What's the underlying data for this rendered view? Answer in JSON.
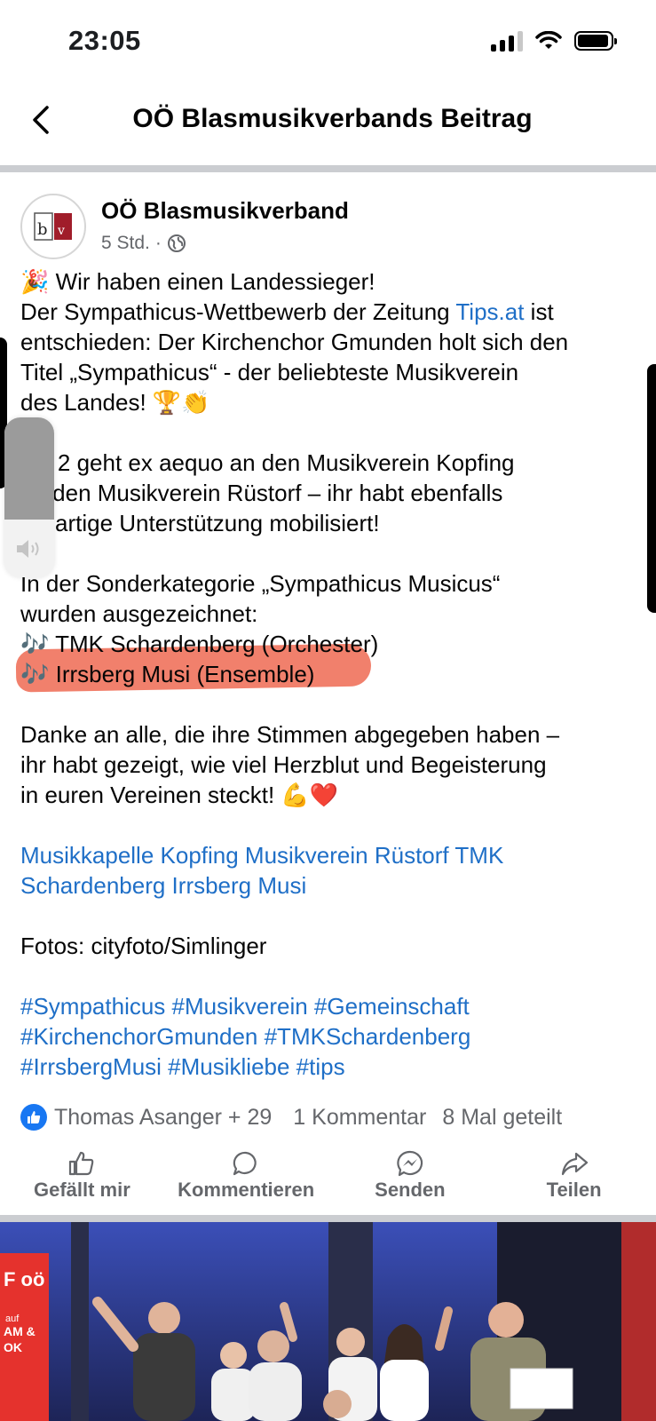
{
  "status_bar": {
    "time": "23:05"
  },
  "header": {
    "title": "OÖ Blasmusikverbands Beitrag"
  },
  "post": {
    "author": "OÖ Blasmusikverband",
    "time": "5 Std.",
    "separator": "·",
    "avatar_letters": "b v",
    "lines": {
      "l1_emoji": "🎉",
      "l1": "Wir haben einen Landessieger!",
      "l2_a": "Der Sympathicus-Wettbewerb der Zeitung ",
      "l2_link": "Tips.at",
      "l2_b": " ist",
      "l3": "entschieden: Der Kirchenchor Gmunden holt sich den",
      "l4": "Titel „Sympathicus“ - der beliebteste Musikverein",
      "l5": "des Landes! 🏆👏",
      "l6": "atz 2 geht ex aequo an den Musikverein Kopfing",
      "l7": "nd den Musikverein Rüstorf – ihr habt ebenfalls",
      "l8": "roßartige Unterstützung mobilisiert!",
      "l9": "In der Sonderkategorie „Sympathicus Musicus“",
      "l10": "wurden ausgezeichnet:",
      "l11": "🎶 TMK Schardenberg (Orchester)",
      "l12": "🎶 Irrsberg Musi (Ensemble)",
      "l13": "Danke an alle, die ihre Stimmen abgegeben haben –",
      "l14": "ihr habt gezeigt, wie viel Herzblut und Begeisterung",
      "l15": "in euren Vereinen steckt! 💪❤️",
      "tags_line1": " Musikkapelle Kopfing Musikverein Rüstorf TMK",
      "tags_line2": "Schardenberg Irrsberg Musi",
      "credits": "Fotos: cityfoto/Simlinger",
      "hashtags_line1": "#Sympathicus #Musikverein #Gemeinschaft",
      "hashtags_line2": "#KirchenchorGmunden #TMKSchardenberg",
      "hashtags_line3": "#IrrsbergMusi #Musikliebe #tips"
    }
  },
  "reactions": {
    "names": "Thomas Asanger + 29",
    "comments": "1 Kommentar",
    "shares": "8 Mal geteilt"
  },
  "actions": {
    "like": "Gefällt mir",
    "comment": "Kommentieren",
    "send": "Senden",
    "share": "Teilen"
  },
  "volume": {
    "level": 0.64
  },
  "photo": {
    "sign_text": "F oö",
    "sign_sub": "auf",
    "sign_sub2": "AM &",
    "sign_sub3": "OK"
  },
  "colors": {
    "link": "#1f6fc7",
    "highlight": "#ef6a52",
    "like_blue": "#1877f2"
  }
}
